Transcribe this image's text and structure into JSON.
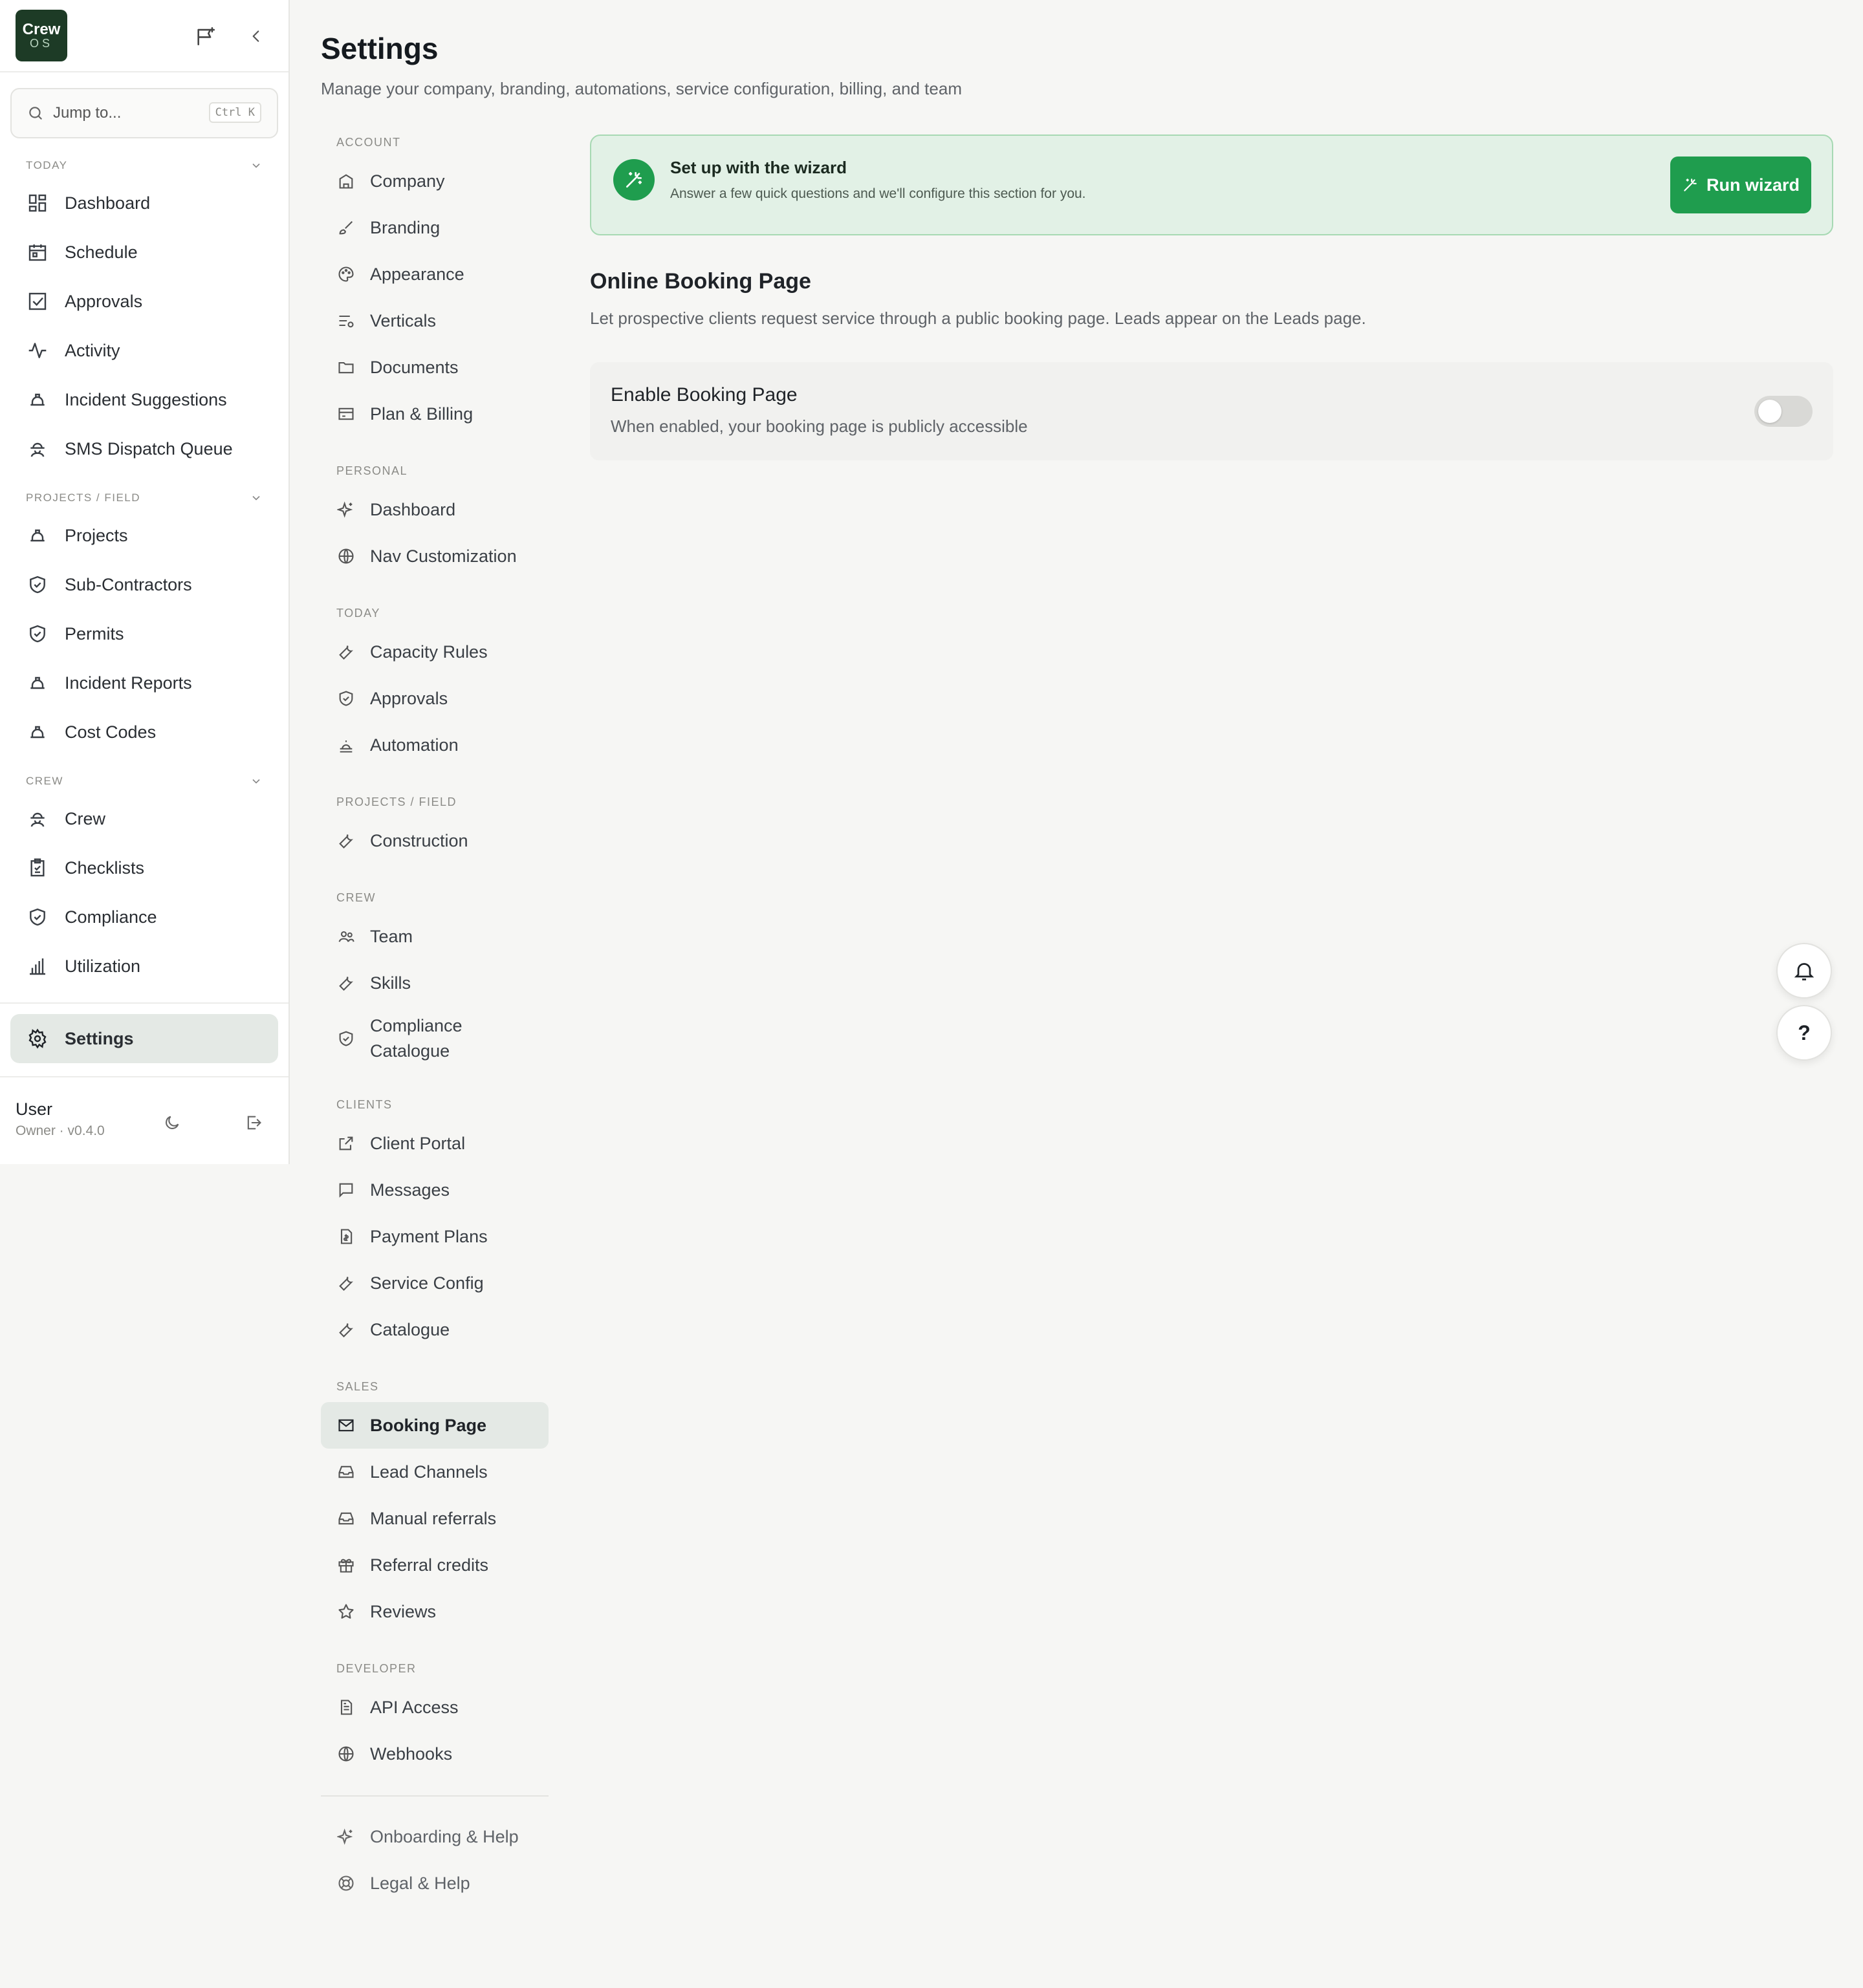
{
  "brand": {
    "line1": "Crew",
    "line2": "OS"
  },
  "search": {
    "placeholder": "Jump to...",
    "shortcut": "Ctrl K"
  },
  "sidebar": {
    "sections": [
      {
        "title": "TODAY",
        "items": [
          {
            "label": "Dashboard",
            "icon": "dashboard-icon"
          },
          {
            "label": "Schedule",
            "icon": "calendar-icon"
          },
          {
            "label": "Approvals",
            "icon": "checkbox-icon"
          },
          {
            "label": "Activity",
            "icon": "activity-icon"
          },
          {
            "label": "Incident Suggestions",
            "icon": "hardhat-icon"
          },
          {
            "label": "SMS Dispatch Queue",
            "icon": "hardhat-person-icon"
          }
        ]
      },
      {
        "title": "PROJECTS / FIELD",
        "items": [
          {
            "label": "Projects",
            "icon": "hardhat-icon"
          },
          {
            "label": "Sub-Contractors",
            "icon": "shield-icon"
          },
          {
            "label": "Permits",
            "icon": "shield-icon"
          },
          {
            "label": "Incident Reports",
            "icon": "hardhat-icon"
          },
          {
            "label": "Cost Codes",
            "icon": "hardhat-icon"
          }
        ]
      },
      {
        "title": "CREW",
        "items": [
          {
            "label": "Crew",
            "icon": "hardhat-person-icon"
          },
          {
            "label": "Checklists",
            "icon": "clipboard-icon"
          },
          {
            "label": "Compliance",
            "icon": "shield-icon"
          },
          {
            "label": "Utilization",
            "icon": "bar-chart-icon"
          }
        ]
      }
    ],
    "settings_label": "Settings",
    "user": {
      "name": "User",
      "meta": "Owner · v0.4.0"
    }
  },
  "page": {
    "title": "Settings",
    "subtitle": "Manage your company, branding, automations, service configuration, billing, and team"
  },
  "settings_nav": {
    "groups": [
      {
        "title": "ACCOUNT",
        "items": [
          "Company",
          "Branding",
          "Appearance",
          "Verticals",
          "Documents",
          "Plan & Billing"
        ]
      },
      {
        "title": "PERSONAL",
        "items": [
          "Dashboard",
          "Nav Customization"
        ]
      },
      {
        "title": "TODAY",
        "items": [
          "Capacity Rules",
          "Approvals",
          "Automation"
        ]
      },
      {
        "title": "PROJECTS / FIELD",
        "items": [
          "Construction"
        ]
      },
      {
        "title": "CREW",
        "items": [
          "Team",
          "Skills",
          "Compliance Catalogue"
        ]
      },
      {
        "title": "CLIENTS",
        "items": [
          "Client Portal",
          "Messages",
          "Payment Plans",
          "Service Config",
          "Catalogue"
        ]
      },
      {
        "title": "SALES",
        "items": [
          "Booking Page",
          "Lead Channels",
          "Manual referrals",
          "Referral credits",
          "Reviews"
        ]
      },
      {
        "title": "DEVELOPER",
        "items": [
          "API Access",
          "Webhooks"
        ]
      }
    ],
    "footer_items": [
      "Onboarding & Help",
      "Legal & Help"
    ],
    "active": "Booking Page"
  },
  "wizard": {
    "title": "Set up with the wizard",
    "description": "Answer a few quick questions and we'll configure this section for you.",
    "button": "Run wizard"
  },
  "booking": {
    "title": "Online Booking Page",
    "description": "Let prospective clients request service through a public booking page. Leads appear on the Leads page.",
    "setting_label": "Enable Booking Page",
    "setting_help": "When enabled, your booking page is publicly accessible",
    "enabled": false
  },
  "floating": {
    "help_label": "?"
  },
  "colors": {
    "accent": "#1f9d4e",
    "logo_bg": "#1d3b26",
    "active_bg": "#e4e9e5"
  }
}
